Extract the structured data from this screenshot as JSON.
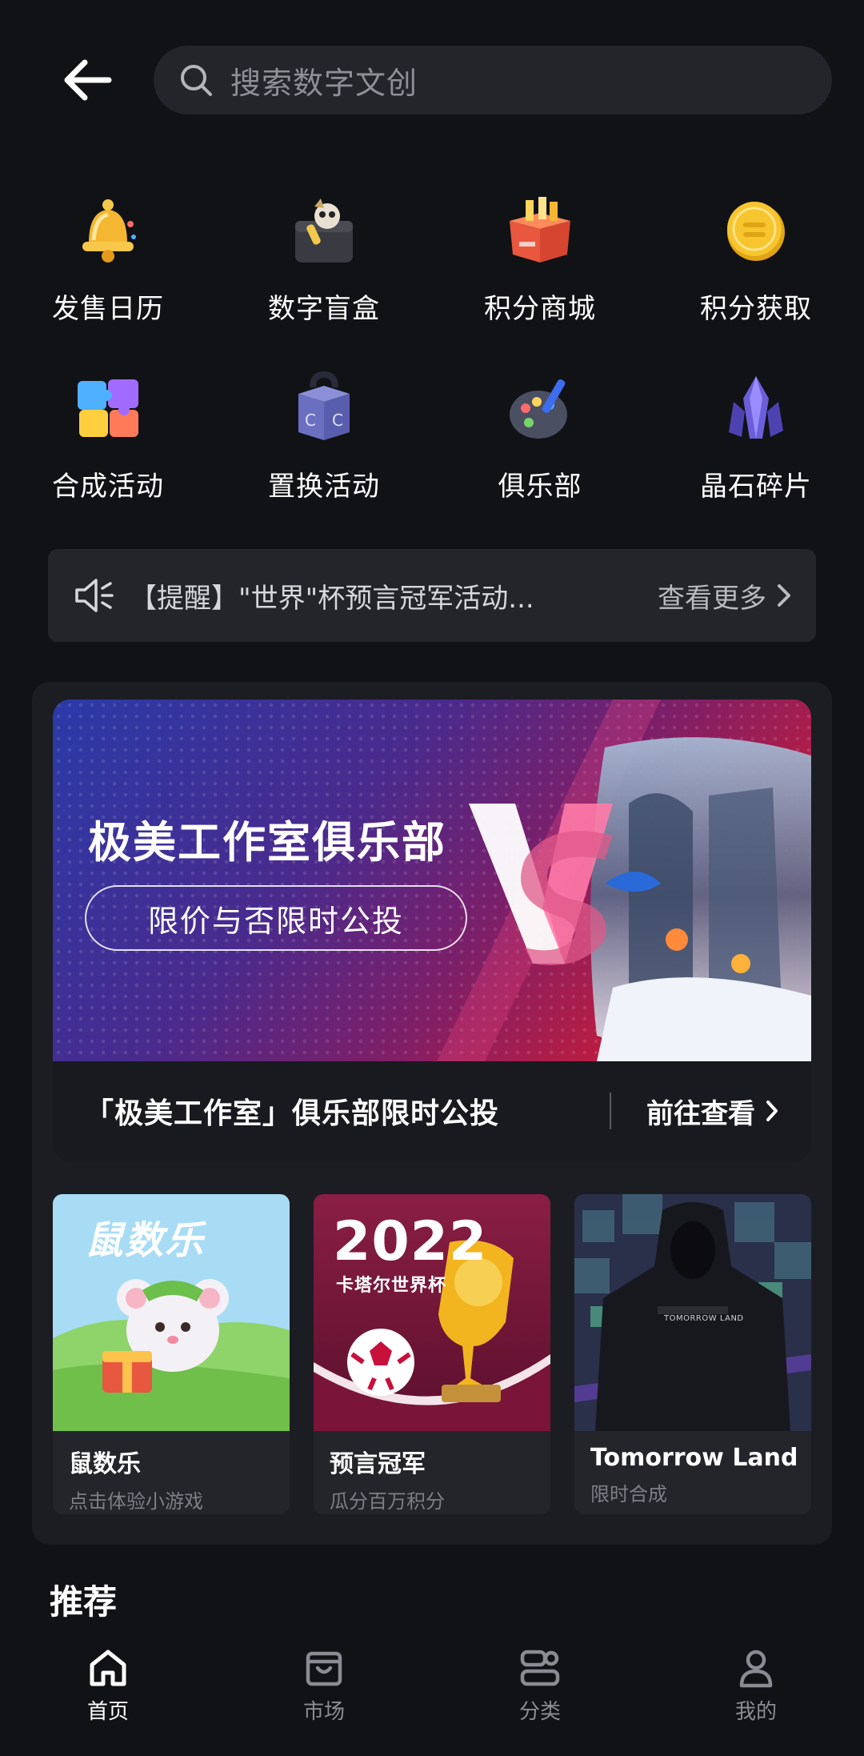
{
  "search": {
    "placeholder": "搜索数字文创"
  },
  "grid": [
    {
      "label": "发售日历",
      "icon": "bell-icon"
    },
    {
      "label": "数字盲盒",
      "icon": "blind-box-icon"
    },
    {
      "label": "积分商城",
      "icon": "gift-box-icon"
    },
    {
      "label": "积分获取",
      "icon": "coin-icon"
    },
    {
      "label": "合成活动",
      "icon": "puzzle-icon"
    },
    {
      "label": "置换活动",
      "icon": "exchange-box-icon"
    },
    {
      "label": "俱乐部",
      "icon": "palette-icon"
    },
    {
      "label": "晶石碎片",
      "icon": "crystal-icon"
    }
  ],
  "notice": {
    "text": "【提醒】\"世界\"杯预言冠军活动...",
    "more": "查看更多"
  },
  "feature": {
    "banner_title": "极美工作室俱乐部",
    "banner_pill": "限价与否限时公投",
    "caption": "「极美工作室」俱乐部限时公投",
    "goto": "前往查看"
  },
  "cards": [
    {
      "name": "鼠数乐",
      "sub": "点击体验小游戏",
      "art_text": "鼠数乐"
    },
    {
      "name": "预言冠军",
      "sub": "瓜分百万积分",
      "art_year": "2022",
      "art_text": "卡塔尔世界杯"
    },
    {
      "name": "Tomorrow Land",
      "sub": "限时合成",
      "art_text": "TOMORROW LAND"
    }
  ],
  "section_title": "推荐",
  "tabs": [
    {
      "label": "首页",
      "icon": "home-icon",
      "active": true
    },
    {
      "label": "市场",
      "icon": "bag-icon",
      "active": false
    },
    {
      "label": "分类",
      "icon": "category-icon",
      "active": false
    },
    {
      "label": "我的",
      "icon": "user-icon",
      "active": false
    }
  ]
}
